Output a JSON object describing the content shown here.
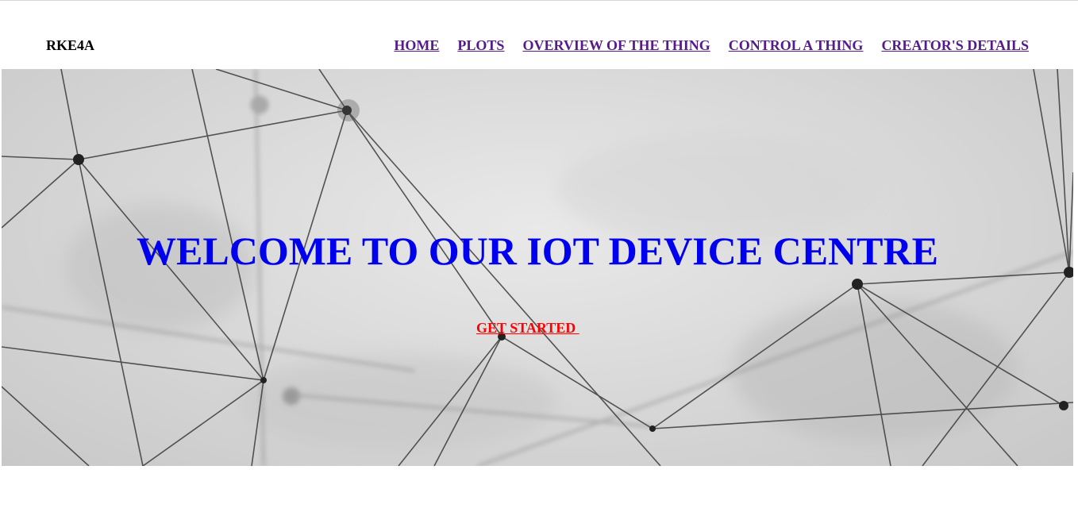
{
  "brand": {
    "name": "RKE4A"
  },
  "nav": {
    "items": [
      {
        "label": "HOME"
      },
      {
        "label": "PLOTS"
      },
      {
        "label": "OVERVIEW OF THE THING"
      },
      {
        "label": "CONTROL A THING"
      },
      {
        "label": "CREATOR'S DETAILS"
      }
    ]
  },
  "hero": {
    "title": "WELCOME TO OUR IOT DEVICE CENTRE",
    "cta_label": "GET STARTED "
  },
  "colors": {
    "nav_link": "#551a8b",
    "hero_title": "#0000ee",
    "cta": "#ff0000",
    "brand": "#000000"
  }
}
